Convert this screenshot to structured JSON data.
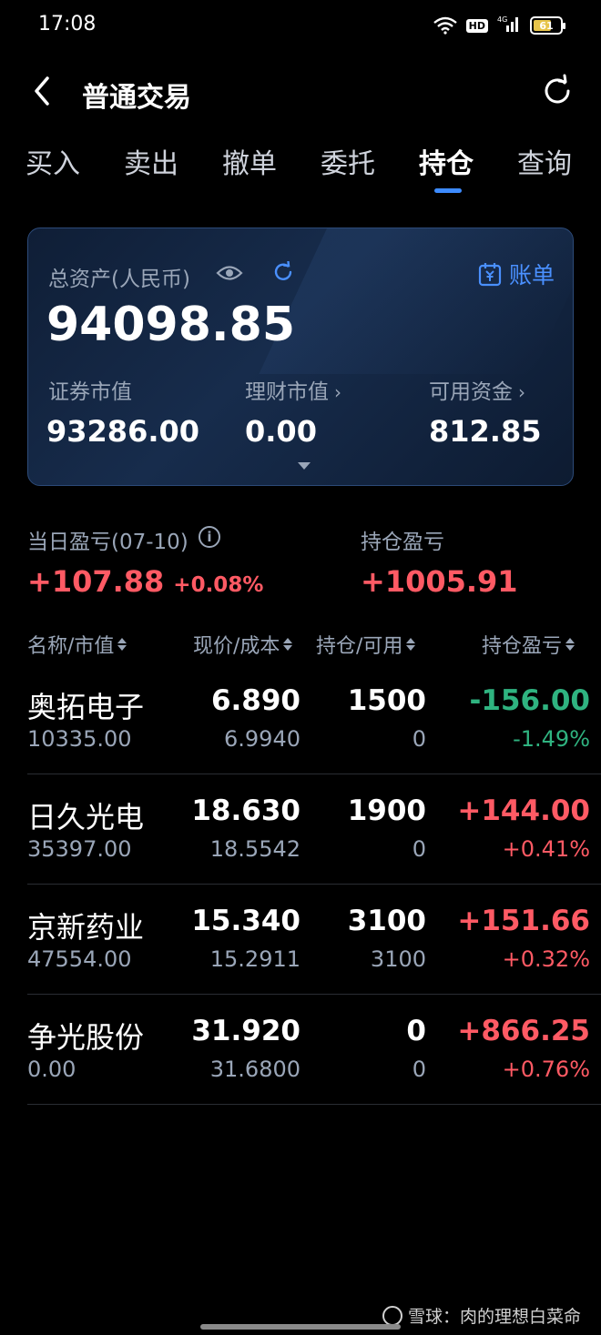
{
  "status_bar": {
    "time": "17:08",
    "network": "4G",
    "hd": "HD",
    "battery": "61"
  },
  "nav": {
    "title": "普通交易",
    "back_icon": "chevron-left-icon",
    "refresh_icon": "refresh-icon"
  },
  "tabs": [
    {
      "label": "买入"
    },
    {
      "label": "卖出"
    },
    {
      "label": "撤单"
    },
    {
      "label": "委托"
    },
    {
      "label": "持仓",
      "active": true
    },
    {
      "label": "查询"
    }
  ],
  "asset_card": {
    "total_label": "总资产(人民币)",
    "total_value": "94098.85",
    "bill_label": "账单",
    "securities_label": "证券市值",
    "securities_value": "93286.00",
    "wealth_label": "理财市值",
    "wealth_value": "0.00",
    "available_label": "可用资金",
    "available_value": "812.85"
  },
  "pnl": {
    "daily_label": "当日盈亏(07-10)",
    "daily_value": "+107.88",
    "daily_pct": "+0.08%",
    "holding_label": "持仓盈亏",
    "holding_value": "+1005.91"
  },
  "table": {
    "headers": {
      "name": "名称/市值",
      "price": "现价/成本",
      "qty": "持仓/可用",
      "pnl": "持仓盈亏"
    },
    "rows": [
      {
        "name": "奥拓电子",
        "market_value": "10335.00",
        "price": "6.890",
        "cost": "6.9940",
        "qty": "1500",
        "available": "0",
        "pnl": "-156.00",
        "pnl_pct": "-1.49%",
        "direction": "down"
      },
      {
        "name": "日久光电",
        "market_value": "35397.00",
        "price": "18.630",
        "cost": "18.5542",
        "qty": "1900",
        "available": "0",
        "pnl": "+144.00",
        "pnl_pct": "+0.41%",
        "direction": "up"
      },
      {
        "name": "京新药业",
        "market_value": "47554.00",
        "price": "15.340",
        "cost": "15.2911",
        "qty": "3100",
        "available": "3100",
        "pnl": "+151.66",
        "pnl_pct": "+0.32%",
        "direction": "up"
      },
      {
        "name": "争光股份",
        "market_value": "0.00",
        "price": "31.920",
        "cost": "31.6800",
        "qty": "0",
        "available": "0",
        "pnl": "+866.25",
        "pnl_pct": "+0.76%",
        "direction": "up"
      }
    ]
  },
  "watermark": "雪球：肉的理想白菜命",
  "colors": {
    "accent": "#3d8bff",
    "gain": "#ff5a64",
    "loss": "#2fb380",
    "card_bg": "#172c4c"
  }
}
